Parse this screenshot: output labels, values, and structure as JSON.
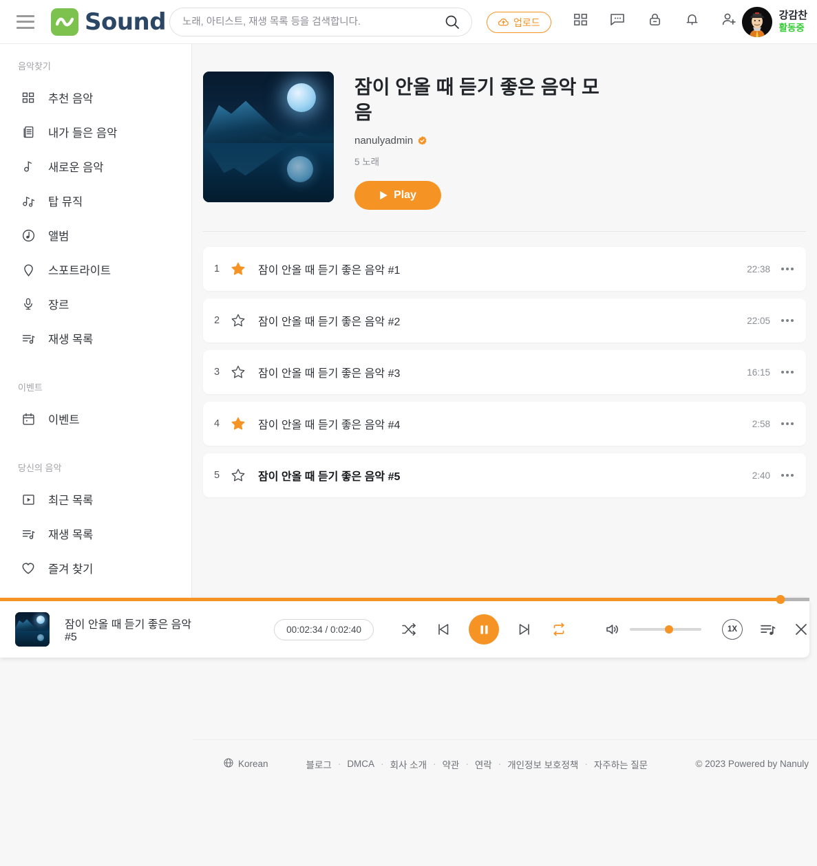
{
  "brand": {
    "name": "Sound",
    "logo_color": "#7dc24f",
    "text_color": "#2c4766"
  },
  "accent": "#f59425",
  "header": {
    "menu_icon": "hamburger-icon",
    "search": {
      "placeholder": "노래, 아티스트, 재생 목록 등을 검색합니다.",
      "value": ""
    },
    "upload_label": "업로드",
    "icons": [
      "grid-icon",
      "chat-icon",
      "lock-icon",
      "bell-icon",
      "add-user-icon"
    ],
    "user": {
      "name": "강감찬",
      "status": "활동중",
      "status_color": "#33cc33"
    }
  },
  "sidebar": {
    "sections": [
      {
        "title": "음악찾기",
        "items": [
          {
            "label": "추천 음악",
            "icon": "grid-icon"
          },
          {
            "label": "내가 들은 음악",
            "icon": "history-list-icon"
          },
          {
            "label": "새로운 음악",
            "icon": "music-note-icon"
          },
          {
            "label": "탑 뮤직",
            "icon": "double-note-icon"
          },
          {
            "label": "앨범",
            "icon": "album-disc-icon"
          },
          {
            "label": "스포트라이트",
            "icon": "pin-icon"
          },
          {
            "label": "장르",
            "icon": "microphone-icon"
          },
          {
            "label": "재생 목록",
            "icon": "playlist-icon"
          }
        ]
      },
      {
        "title": "이벤트",
        "items": [
          {
            "label": "이벤트",
            "icon": "calendar-icon"
          }
        ]
      },
      {
        "title": "당신의 음악",
        "items": [
          {
            "label": "최근 목록",
            "icon": "play-box-icon"
          },
          {
            "label": "재생 목록",
            "icon": "playlist-icon"
          },
          {
            "label": "즐겨 찾기",
            "icon": "heart-icon"
          }
        ]
      }
    ]
  },
  "playlist": {
    "title": "잠이 안올 때 듣기 좋은 음악 모음",
    "owner": "nanulyadmin",
    "verified": true,
    "track_count_label": "5 노래",
    "play_label": "Play",
    "cover_alt": "moon-over-lake-cover"
  },
  "tracks": [
    {
      "num": "1",
      "favorite": true,
      "title": "잠이 안올 때 듣기 좋은 음악 #1",
      "duration": "22:38",
      "playing": false
    },
    {
      "num": "2",
      "favorite": false,
      "title": "잠이 안올 때 듣기 좋은 음악 #2",
      "duration": "22:05",
      "playing": false
    },
    {
      "num": "3",
      "favorite": false,
      "title": "잠이 안올 때 듣기 좋은 음악 #3",
      "duration": "16:15",
      "playing": false
    },
    {
      "num": "4",
      "favorite": true,
      "title": "잠이 안올 때 듣기 좋은 음악 #4",
      "duration": "2:58",
      "playing": false
    },
    {
      "num": "5",
      "favorite": false,
      "title": "잠이 안올 때 듣기 좋은 음악 #5",
      "duration": "2:40",
      "playing": true
    }
  ],
  "player": {
    "now_playing": "잠이 안올 때 듣기 좋은 음악 #5",
    "time_display": "00:02:34 / 0:02:40",
    "progress_percent": 96.4,
    "state": "playing",
    "shuffle": false,
    "repeat": true,
    "volume_percent": 55,
    "speed_label": "1X",
    "controls": [
      "shuffle-icon",
      "previous-icon",
      "pause-icon",
      "next-icon",
      "repeat-icon",
      "volume-icon",
      "speed-button",
      "queue-icon",
      "close-icon"
    ]
  },
  "footer": {
    "language": "Korean",
    "links": [
      "블로그",
      "DMCA",
      "회사 소개",
      "약관",
      "연락",
      "개인정보 보호정책",
      "자주하는 질문"
    ],
    "separator": "·",
    "copyright": "© 2023 Powered by Nanuly"
  }
}
